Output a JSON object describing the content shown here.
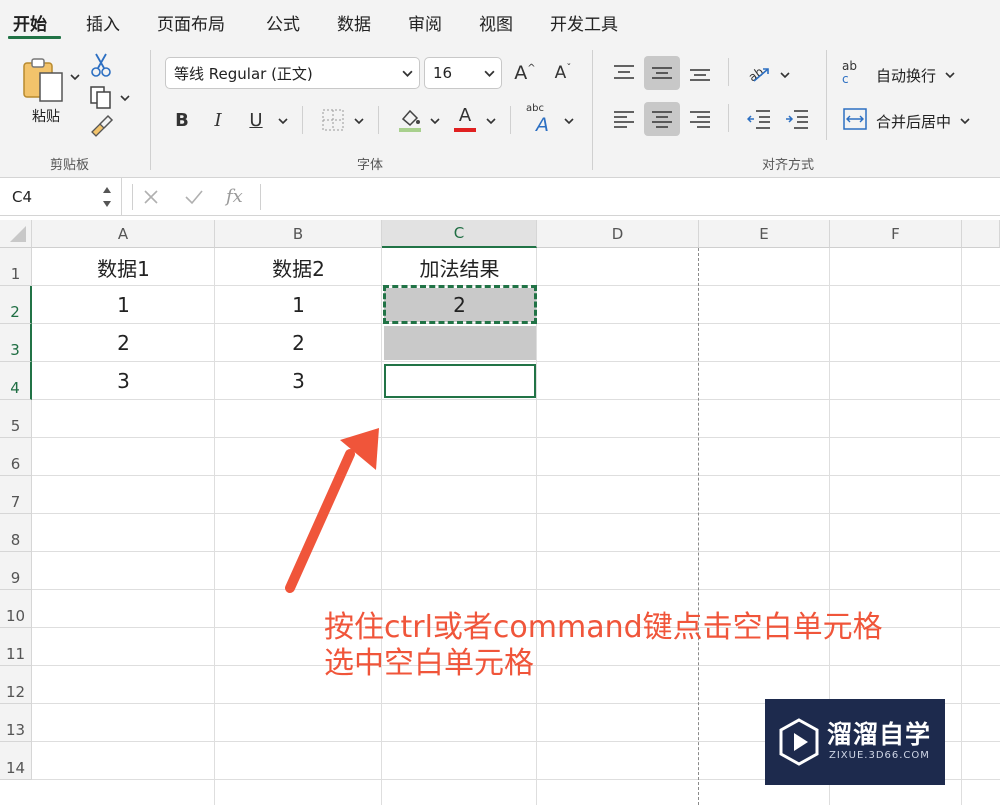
{
  "tabs": [
    {
      "label": "开始",
      "active": true
    },
    {
      "label": "插入"
    },
    {
      "label": "页面布局"
    },
    {
      "label": "公式"
    },
    {
      "label": "数据"
    },
    {
      "label": "审阅"
    },
    {
      "label": "视图"
    },
    {
      "label": "开发工具"
    }
  ],
  "clipboard": {
    "paste_label": "粘贴",
    "group_label": "剪贴板"
  },
  "font": {
    "family": "等线 Regular (正文)",
    "size": "16",
    "bold": "B",
    "italic": "I",
    "underline": "U",
    "grow": "A",
    "shrink": "A",
    "font_color_glyph": "A",
    "phonetic_small": "abc",
    "phonetic_big": "A",
    "group_label": "字体",
    "fill_color": "#a8d08d",
    "text_color": "#e02020"
  },
  "alignment": {
    "wrap_label": "自动换行",
    "wrap_icon_top": "ab",
    "wrap_icon_bottom": "c",
    "merge_label": "合并后居中",
    "group_label": "对齐方式"
  },
  "formula_bar": {
    "name_box": "C4",
    "fx": "fx",
    "formula": ""
  },
  "sheet": {
    "columns": [
      "A",
      "B",
      "C",
      "D",
      "E",
      "F"
    ],
    "selected_column": "C",
    "rows": [
      "1",
      "2",
      "3",
      "4",
      "5",
      "6",
      "7",
      "8",
      "9",
      "10",
      "11",
      "12",
      "13",
      "14"
    ],
    "selected_rows": [
      "2",
      "3",
      "4"
    ],
    "cells": {
      "A1": "数据1",
      "B1": "数据2",
      "C1": "加法结果",
      "A2": "1",
      "B2": "1",
      "C2": "2",
      "A3": "2",
      "B3": "2",
      "A4": "3",
      "B4": "3"
    },
    "active_cell": "C4",
    "selection_fill": "#c9c9c9",
    "accent": "#217346"
  },
  "annotation": {
    "line1": "按住ctrl或者command键点击空白单元格",
    "line2": "选中空白单元格",
    "color": "#f0553a"
  },
  "watermark": {
    "title": "溜溜自学",
    "subtitle": "ZIXUE.3D66.COM"
  }
}
